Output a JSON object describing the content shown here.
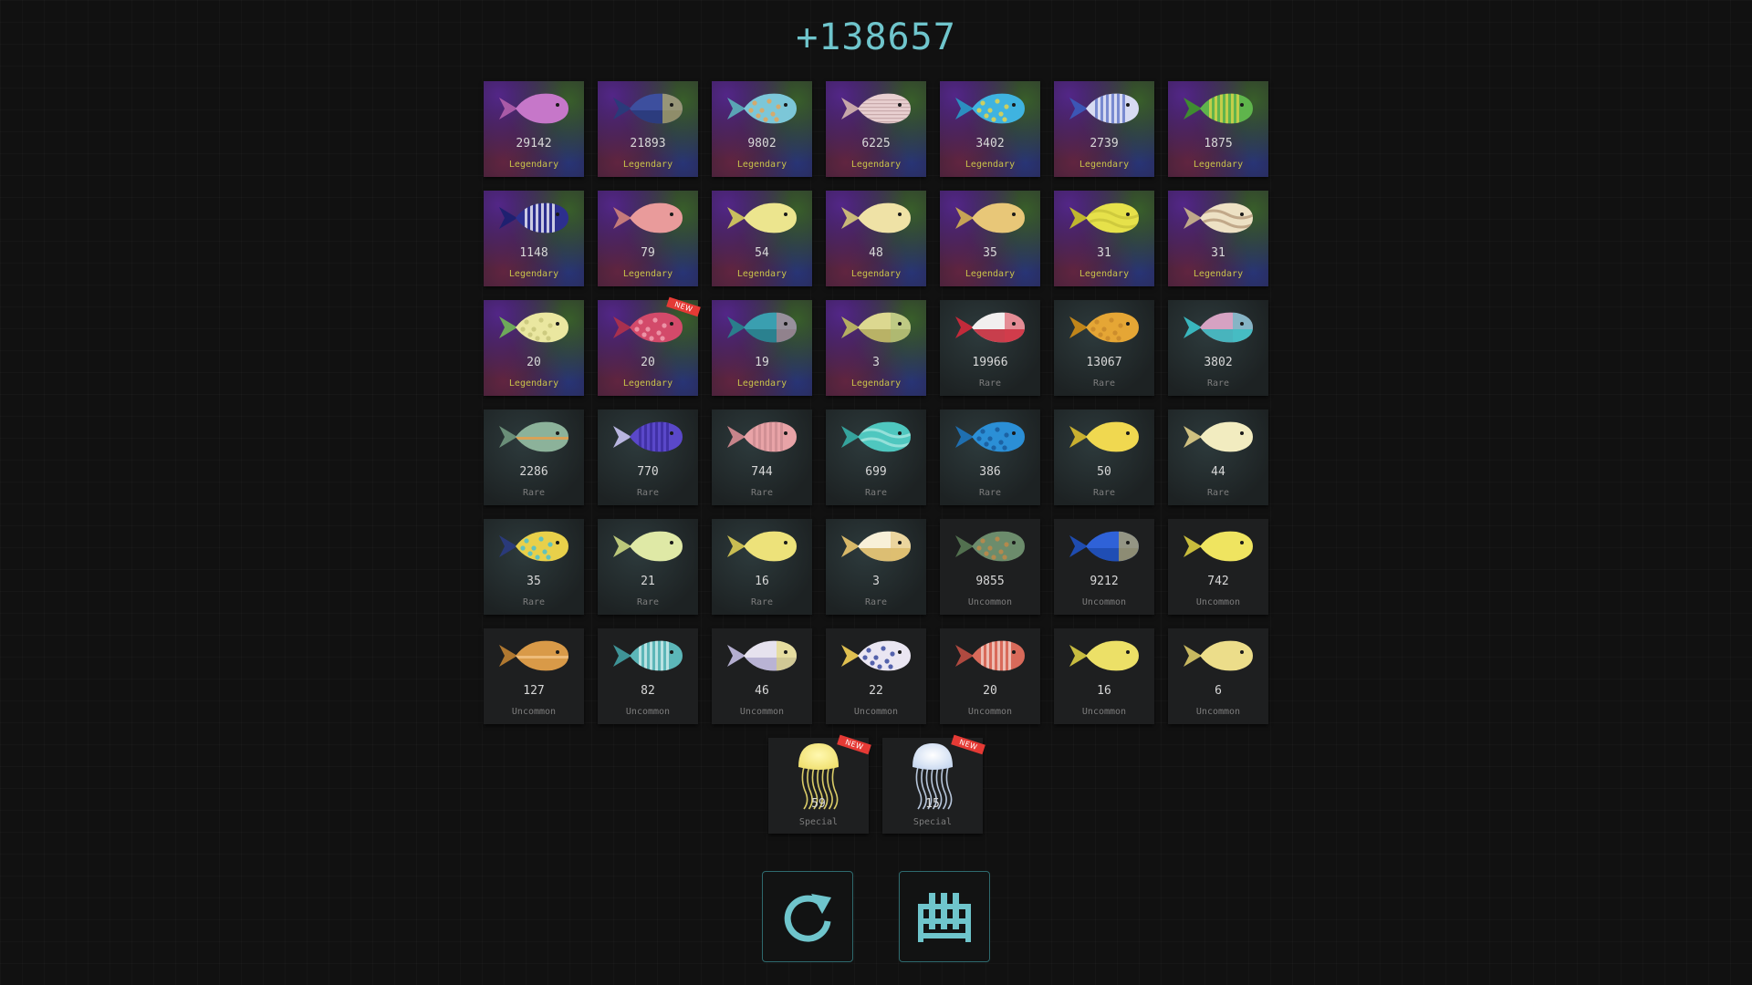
{
  "score": "+138657",
  "new_badge": "NEW",
  "colors": {
    "accent": "#6fc5cc",
    "badge": "#e53a35",
    "legendary_label": "#c9c24a"
  },
  "fish": [
    {
      "count": "29142",
      "rarity": "Legendary",
      "body": "#c677c9",
      "tail": "#a95aa7",
      "pattern": "none",
      "accent": "#8a3aa0"
    },
    {
      "count": "21893",
      "rarity": "Legendary",
      "body": "#3d4f9e",
      "tail": "#2a3a7a",
      "pattern": "split",
      "accent": "#e2cf5a"
    },
    {
      "count": "9802",
      "rarity": "Legendary",
      "body": "#7cc7d8",
      "tail": "#5aa4b5",
      "pattern": "dots",
      "accent": "#e4a45a"
    },
    {
      "count": "6225",
      "rarity": "Legendary",
      "body": "#e8cfd0",
      "tail": "#c7a7a9",
      "pattern": "lines",
      "accent": "#c0a0a2"
    },
    {
      "count": "3402",
      "rarity": "Legendary",
      "body": "#3fb3e0",
      "tail": "#2b8fc0",
      "pattern": "dots",
      "accent": "#e4d34a"
    },
    {
      "count": "2739",
      "rarity": "Legendary",
      "body": "#d7dbf2",
      "tail": "#3c56b5",
      "pattern": "stripes",
      "accent": "#5a6fc4"
    },
    {
      "count": "1875",
      "rarity": "Legendary",
      "body": "#5fb44c",
      "tail": "#3f8c30",
      "pattern": "stripes",
      "accent": "#e3d74a"
    },
    {
      "count": "1148",
      "rarity": "Legendary",
      "body": "#2d2f8e",
      "tail": "#1f2070",
      "pattern": "stripes",
      "accent": "#ffffff"
    },
    {
      "count": "79",
      "rarity": "Legendary",
      "body": "#e99b9b",
      "tail": "#c47a7a",
      "pattern": "none",
      "accent": "#c47a7a"
    },
    {
      "count": "54",
      "rarity": "Legendary",
      "body": "#ece58e",
      "tail": "#c9be5e",
      "pattern": "none",
      "accent": "#c9be5e"
    },
    {
      "count": "48",
      "rarity": "Legendary",
      "body": "#efe2a6",
      "tail": "#c9b878",
      "pattern": "none",
      "accent": "#c9b878"
    },
    {
      "count": "35",
      "rarity": "Legendary",
      "body": "#e8c778",
      "tail": "#c7a455",
      "pattern": "none",
      "accent": "#c7a455"
    },
    {
      "count": "31",
      "rarity": "Legendary",
      "body": "#e6e14a",
      "tail": "#c0b72f",
      "pattern": "wave",
      "accent": "#c9c43a"
    },
    {
      "count": "31",
      "rarity": "Legendary",
      "body": "#ede1c4",
      "tail": "#bfa889",
      "pattern": "wave",
      "accent": "#b59a7a"
    },
    {
      "count": "20",
      "rarity": "Legendary",
      "body": "#eae7a0",
      "tail": "#6ea85a",
      "pattern": "dots",
      "accent": "#c8c57a"
    },
    {
      "count": "20",
      "rarity": "Legendary",
      "body": "#d34a6a",
      "tail": "#a8304e",
      "pattern": "dots",
      "accent": "#f0a0b0",
      "isNew": true
    },
    {
      "count": "19",
      "rarity": "Legendary",
      "body": "#3a9fb0",
      "tail": "#2a7d8c",
      "pattern": "split",
      "accent": "#e6838c"
    },
    {
      "count": "3",
      "rarity": "Legendary",
      "body": "#dcd890",
      "tail": "#b5ae62",
      "pattern": "split",
      "accent": "#a7c07a"
    },
    {
      "count": "19966",
      "rarity": "Rare",
      "body": "#f1efef",
      "tail": "#c32a3a",
      "pattern": "split",
      "accent": "#d83a4a"
    },
    {
      "count": "13067",
      "rarity": "Rare",
      "body": "#e5a635",
      "tail": "#c0851a",
      "pattern": "dots",
      "accent": "#c8882a"
    },
    {
      "count": "3802",
      "rarity": "Rare",
      "body": "#d6a2c2",
      "tail": "#39b6bd",
      "pattern": "split",
      "accent": "#46c3c8"
    },
    {
      "count": "2286",
      "rarity": "Rare",
      "body": "#8cb29a",
      "tail": "#6a8e78",
      "pattern": "line",
      "accent": "#e0a050"
    },
    {
      "count": "770",
      "rarity": "Rare",
      "body": "#5a48c9",
      "tail": "#b9b6e0",
      "pattern": "stripes",
      "accent": "#3a2a9a"
    },
    {
      "count": "744",
      "rarity": "Rare",
      "body": "#e8a3a7",
      "tail": "#c7848a",
      "pattern": "stripes",
      "accent": "#c98a8f"
    },
    {
      "count": "699",
      "rarity": "Rare",
      "body": "#4fc7bf",
      "tail": "#35a39c",
      "pattern": "wave",
      "accent": "#a5e6e0"
    },
    {
      "count": "386",
      "rarity": "Rare",
      "body": "#2b8fd6",
      "tail": "#1f6fb0",
      "pattern": "dots",
      "accent": "#1a5a9a"
    },
    {
      "count": "50",
      "rarity": "Rare",
      "body": "#f0d850",
      "tail": "#c9b030",
      "pattern": "none",
      "accent": "#c9b030"
    },
    {
      "count": "44",
      "rarity": "Rare",
      "body": "#f2ecc0",
      "tail": "#cfc080",
      "pattern": "none",
      "accent": "#cfc080"
    },
    {
      "count": "35",
      "rarity": "Rare",
      "body": "#e8d04a",
      "tail": "#2a3a7a",
      "pattern": "dots",
      "accent": "#4ac0d0"
    },
    {
      "count": "21",
      "rarity": "Rare",
      "body": "#dfe9a6",
      "tail": "#bcc87a",
      "pattern": "none",
      "accent": "#bcc87a"
    },
    {
      "count": "16",
      "rarity": "Rare",
      "body": "#ede27a",
      "tail": "#c9bd52",
      "pattern": "none",
      "accent": "#c9bd52"
    },
    {
      "count": "3",
      "rarity": "Rare",
      "body": "#f8f0d8",
      "tail": "#d8b868",
      "pattern": "split",
      "accent": "#e0c070"
    },
    {
      "count": "9855",
      "rarity": "Uncommon",
      "body": "#6c8c6c",
      "tail": "#52704f",
      "pattern": "dots",
      "accent": "#c08848"
    },
    {
      "count": "9212",
      "rarity": "Uncommon",
      "body": "#2f62d8",
      "tail": "#1f4cb0",
      "pattern": "split",
      "accent": "#e8c040"
    },
    {
      "count": "742",
      "rarity": "Uncommon",
      "body": "#efe460",
      "tail": "#c8bc3c",
      "pattern": "none",
      "accent": "#c8bc3c"
    },
    {
      "count": "127",
      "rarity": "Uncommon",
      "body": "#d99a48",
      "tail": "#b07830",
      "pattern": "line",
      "accent": "#f0c080"
    },
    {
      "count": "82",
      "rarity": "Uncommon",
      "body": "#5cb6b8",
      "tail": "#3f9497",
      "pattern": "stripes",
      "accent": "#d8f0f0"
    },
    {
      "count": "46",
      "rarity": "Uncommon",
      "body": "#e6e2ee",
      "tail": "#b4aed0",
      "pattern": "split",
      "accent": "#e6d860"
    },
    {
      "count": "22",
      "rarity": "Uncommon",
      "body": "#eae6f2",
      "tail": "#e0c050",
      "pattern": "dots",
      "accent": "#3a4aa0"
    },
    {
      "count": "20",
      "rarity": "Uncommon",
      "body": "#d86a5a",
      "tail": "#b04a40",
      "pattern": "stripes",
      "accent": "#f4d8d0"
    },
    {
      "count": "16",
      "rarity": "Uncommon",
      "body": "#ece067",
      "tail": "#c8bc40",
      "pattern": "none",
      "accent": "#c8bc40"
    },
    {
      "count": "6",
      "rarity": "Uncommon",
      "body": "#ecdd8a",
      "tail": "#c8b860",
      "pattern": "none",
      "accent": "#c8b860"
    }
  ],
  "specials": [
    {
      "count": "59",
      "rarity": "Special",
      "color": "#f0e070",
      "glow": "#fff8b0",
      "isNew": true
    },
    {
      "count": "15",
      "rarity": "Special",
      "color": "#c8d8f0",
      "glow": "#ffffff",
      "isNew": true
    }
  ],
  "buttons": {
    "reset_icon": "refresh-icon",
    "lab_icon": "test-tube-rack-icon"
  }
}
